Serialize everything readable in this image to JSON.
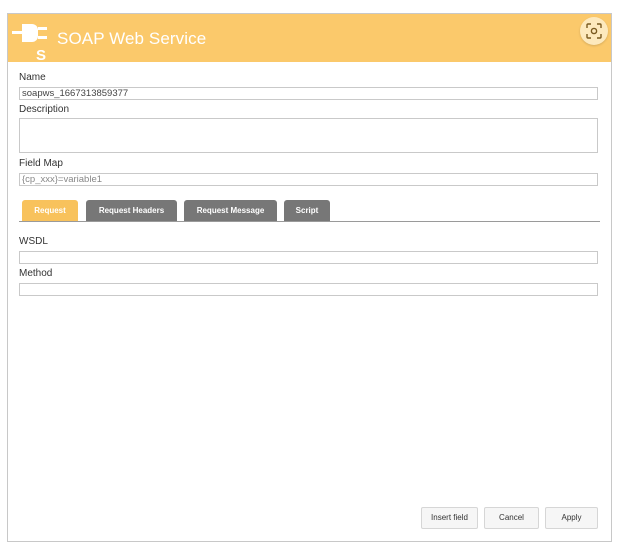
{
  "header": {
    "title": "SOAP Web Service",
    "background_color": "#fbc96b",
    "icon": "plug-s-icon",
    "fullscreen_icon": "focus-frame-icon"
  },
  "form": {
    "name_label": "Name",
    "name_value": "soapws_1667313859377",
    "description_label": "Description",
    "description_value": "",
    "field_map_label": "Field Map",
    "field_map_placeholder": "{cp_xxx}=variable1"
  },
  "tabs": [
    {
      "label": "Request",
      "active": true
    },
    {
      "label": "Request Headers",
      "active": false
    },
    {
      "label": "Request Message",
      "active": false
    },
    {
      "label": "Script",
      "active": false
    }
  ],
  "request": {
    "wsdl_label": "WSDL",
    "wsdl_value": "",
    "method_label": "Method",
    "method_value": ""
  },
  "footer": {
    "insert_field": "Insert field",
    "cancel": "Cancel",
    "apply": "Apply"
  },
  "colors": {
    "accent": "#f8c25c",
    "tab_inactive": "#777777"
  }
}
